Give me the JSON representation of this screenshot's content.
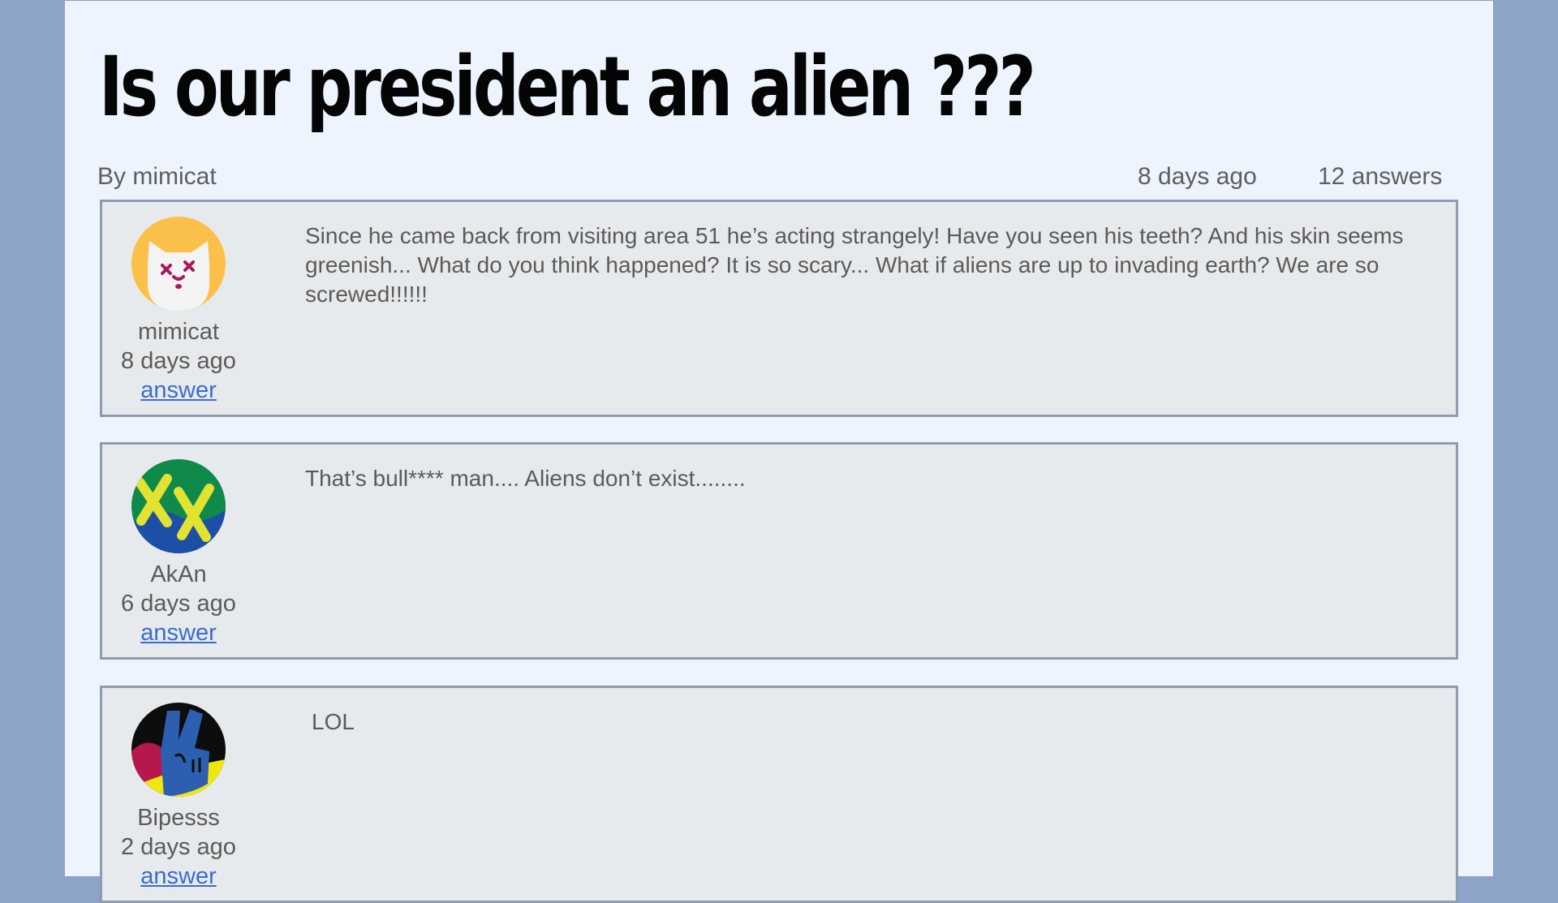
{
  "question": {
    "title": "Is our president an alien ???",
    "author_line": "By mimicat",
    "date": "8 days ago",
    "answers_count": "12 answers"
  },
  "posts": [
    {
      "username": "mimicat",
      "date": "8 days ago",
      "action": "answer",
      "text": "Since he came back from visiting area 51 he’s acting strangely! Have you seen his teeth? And his skin seems greenish... What do you think happened? It is so scary... What if aliens are up to invading earth? We are so screwed!!!!!!",
      "avatar_icon": "cat-avatar-icon"
    },
    {
      "username": "AkAn",
      "date": "6 days ago",
      "action": "answer",
      "text": "That’s bull**** man.... Aliens don’t exist........",
      "avatar_icon": "xx-avatar-icon"
    },
    {
      "username": "Bipesss",
      "date": "2 days ago",
      "action": "answer",
      "text": "LOL",
      "avatar_icon": "peace-hand-avatar-icon"
    }
  ],
  "colors": {
    "background": "#8ea3c8",
    "page": "#edf4fd",
    "post_box": "#e7eaed",
    "link": "#3a6dcf"
  }
}
